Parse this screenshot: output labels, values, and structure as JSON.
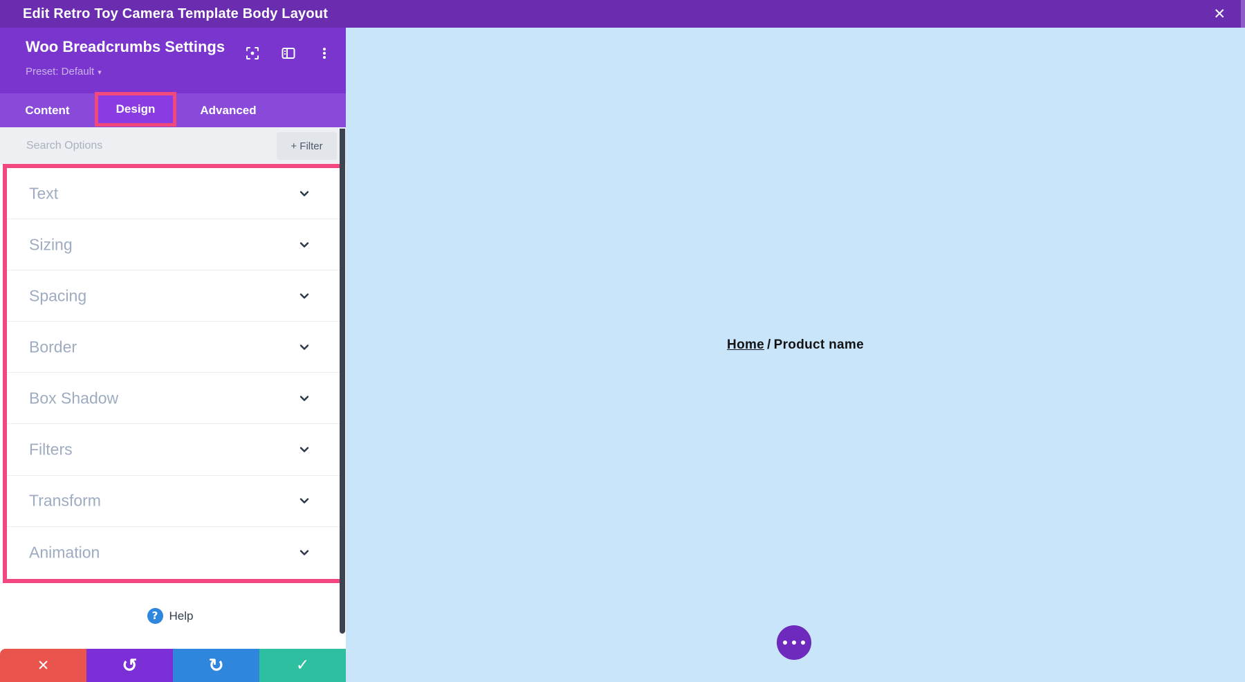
{
  "top_bar": {
    "title": "Edit Retro Toy Camera Template Body Layout"
  },
  "panel": {
    "title": "Woo Breadcrumbs Settings",
    "preset_label": "Preset: Default",
    "tabs": [
      {
        "label": "Content",
        "active": false
      },
      {
        "label": "Design",
        "active": true,
        "highlighted": true
      },
      {
        "label": "Advanced",
        "active": false
      }
    ],
    "search": {
      "placeholder": "Search Options",
      "filter_label": "+ Filter"
    },
    "sections": [
      "Text",
      "Sizing",
      "Spacing",
      "Border",
      "Box Shadow",
      "Filters",
      "Transform",
      "Animation"
    ],
    "help_label": "Help"
  },
  "canvas": {
    "breadcrumb": {
      "home": "Home",
      "separator": "/",
      "current": "Product name"
    }
  },
  "icons": {
    "close": "✕",
    "caret": "▾",
    "help": "?",
    "discard": "✕",
    "undo": "↺",
    "redo": "↻",
    "save": "✓"
  },
  "colors": {
    "top_bar": "#6a2db0",
    "panel_header": "#7a35cf",
    "tab_bar": "#8a4ad9",
    "highlight_pink": "#f1467e",
    "canvas_blue": "#c9e5fa",
    "discard_red": "#e9554d",
    "undo_purple": "#7c2fd6",
    "redo_blue": "#2e87dc",
    "save_green": "#2dbf9f",
    "accent_purple_button": "#6e2abc",
    "help_blue": "#2e86de"
  }
}
